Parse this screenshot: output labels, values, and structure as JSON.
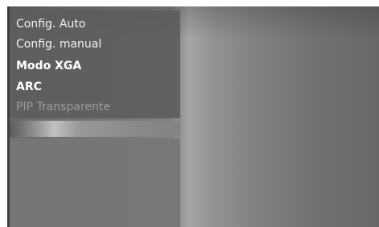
{
  "menu": {
    "items": [
      {
        "label": "Config. Auto",
        "state": "normal"
      },
      {
        "label": "Config. manual",
        "state": "normal"
      },
      {
        "label": "Modo XGA",
        "state": "normal"
      },
      {
        "label": "ARC",
        "state": "normal"
      },
      {
        "label": "PIP Transparente",
        "state": "disabled"
      }
    ]
  },
  "colors": {
    "panel": "#5c5c5c",
    "text": "#f2f2f2",
    "disabled_text": "#9c9c9c"
  }
}
